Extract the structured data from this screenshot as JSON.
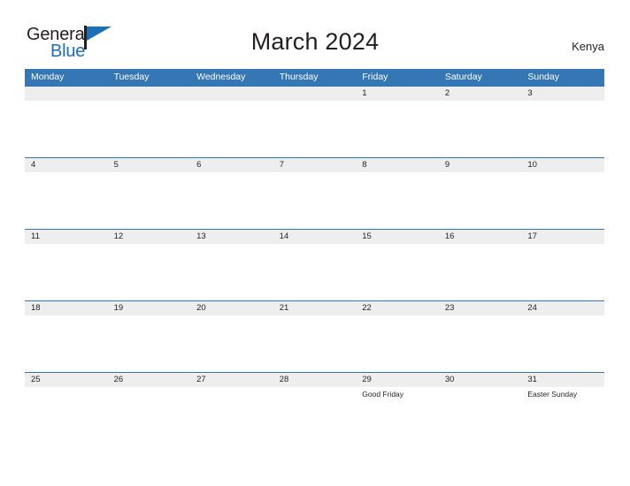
{
  "brand": {
    "name_part1": "General",
    "name_part2": "Blue",
    "flag_icon": "general-blue-flag-icon",
    "accent_color": "#1c6fb5"
  },
  "header": {
    "title": "March 2024",
    "country": "Kenya"
  },
  "theme": {
    "header_blue": "#3576b5",
    "band_gray": "#eeeeee",
    "text_color": "#231f20"
  },
  "calendar": {
    "weekdays": [
      "Monday",
      "Tuesday",
      "Wednesday",
      "Thursday",
      "Friday",
      "Saturday",
      "Sunday"
    ],
    "weeks": [
      [
        {
          "day": "",
          "events": []
        },
        {
          "day": "",
          "events": []
        },
        {
          "day": "",
          "events": []
        },
        {
          "day": "",
          "events": []
        },
        {
          "day": "1",
          "events": []
        },
        {
          "day": "2",
          "events": []
        },
        {
          "day": "3",
          "events": []
        }
      ],
      [
        {
          "day": "4",
          "events": []
        },
        {
          "day": "5",
          "events": []
        },
        {
          "day": "6",
          "events": []
        },
        {
          "day": "7",
          "events": []
        },
        {
          "day": "8",
          "events": []
        },
        {
          "day": "9",
          "events": []
        },
        {
          "day": "10",
          "events": []
        }
      ],
      [
        {
          "day": "11",
          "events": []
        },
        {
          "day": "12",
          "events": []
        },
        {
          "day": "13",
          "events": []
        },
        {
          "day": "14",
          "events": []
        },
        {
          "day": "15",
          "events": []
        },
        {
          "day": "16",
          "events": []
        },
        {
          "day": "17",
          "events": []
        }
      ],
      [
        {
          "day": "18",
          "events": []
        },
        {
          "day": "19",
          "events": []
        },
        {
          "day": "20",
          "events": []
        },
        {
          "day": "21",
          "events": []
        },
        {
          "day": "22",
          "events": []
        },
        {
          "day": "23",
          "events": []
        },
        {
          "day": "24",
          "events": []
        }
      ],
      [
        {
          "day": "25",
          "events": []
        },
        {
          "day": "26",
          "events": []
        },
        {
          "day": "27",
          "events": []
        },
        {
          "day": "28",
          "events": []
        },
        {
          "day": "29",
          "events": [
            "Good Friday"
          ]
        },
        {
          "day": "30",
          "events": []
        },
        {
          "day": "31",
          "events": [
            "Easter Sunday"
          ]
        }
      ]
    ]
  }
}
